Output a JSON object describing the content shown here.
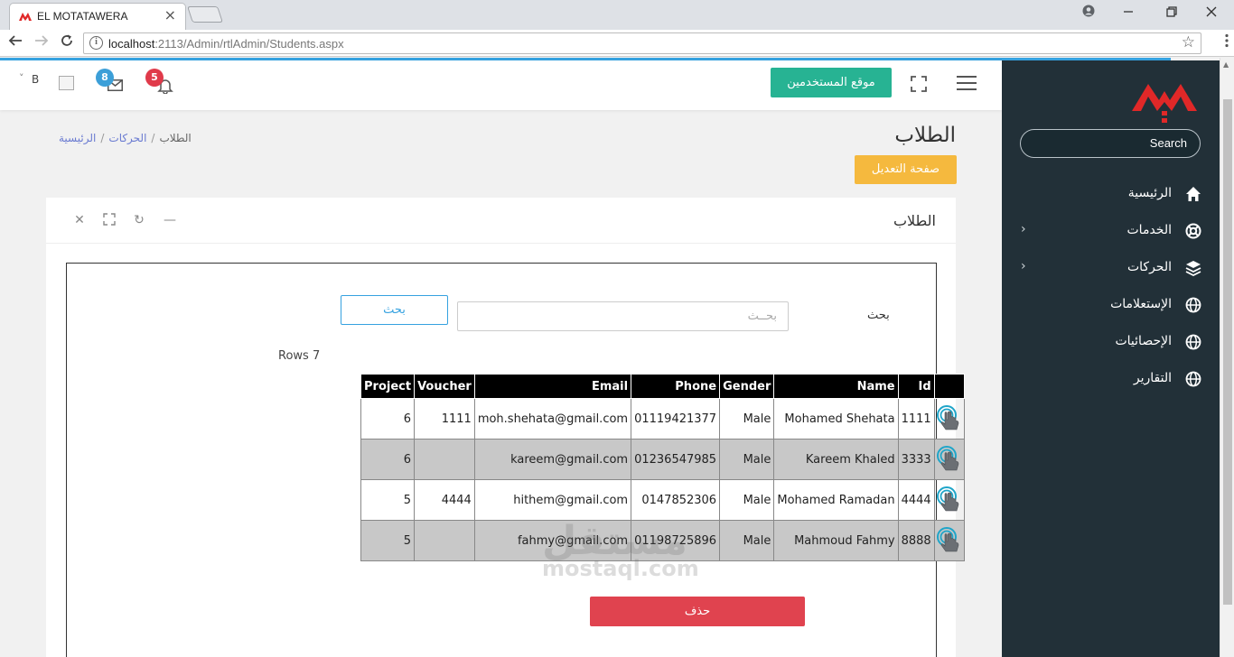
{
  "browser": {
    "tab_title": "EL MOTATAWERA",
    "tab_close": "×",
    "url_host": "localhost",
    "url_rest": ":2113/Admin/rtlAdmin/Students.aspx"
  },
  "sidebar": {
    "search_label": "Search",
    "items": [
      {
        "label": "الرئيسية",
        "icon": "home-icon"
      },
      {
        "label": "الخدمات",
        "icon": "lifebuoy-icon",
        "chevron": "‹"
      },
      {
        "label": "الحركات",
        "icon": "layers-icon",
        "chevron": "‹"
      },
      {
        "label": "الإستعلامات",
        "icon": "globe-icon"
      },
      {
        "label": "الإحصائيات",
        "icon": "globe-icon"
      },
      {
        "label": "التقارير",
        "icon": "globe-icon"
      }
    ]
  },
  "header": {
    "users_site_button": "موقع المستخدمين",
    "notifications_count": "5",
    "messages_count": "8",
    "user_initial": "B",
    "user_chevron": "˅"
  },
  "page": {
    "title": "الطلاب",
    "breadcrumb": {
      "home": "الرئيسية",
      "section": "الحركات",
      "current": "الطلاب"
    },
    "edit_button": "صفحة التعديل"
  },
  "card": {
    "title": "الطلاب",
    "tools": {
      "minimize": "—",
      "refresh": "↻",
      "expand": "⛶",
      "close": "✕"
    }
  },
  "search": {
    "label": "بحث",
    "placeholder": "بحــث",
    "button": "بحث"
  },
  "rows_count_text": "Rows 7",
  "table": {
    "headers": [
      "",
      "Id",
      "Name",
      "Gender",
      "Phone",
      "Email",
      "Voucher",
      "Project"
    ],
    "rows": [
      {
        "id": "1111",
        "name": "Mohamed Shehata",
        "gender": "Male",
        "phone": "01119421377",
        "email": "moh.shehata@gmail.com",
        "voucher": "1111",
        "project": "6"
      },
      {
        "id": "3333",
        "name": "Kareem Khaled",
        "gender": "Male",
        "phone": "01236547985",
        "email": "kareem@gmail.com",
        "voucher": "",
        "project": "6"
      },
      {
        "id": "4444",
        "name": "Mohamed Ramadan",
        "gender": "Male",
        "phone": "0147852306",
        "email": "hithem@gmail.com",
        "voucher": "4444",
        "project": "5"
      },
      {
        "id": "8888",
        "name": "Mahmoud Fahmy",
        "gender": "Male",
        "phone": "01198725896",
        "email": "fahmy@gmail.com",
        "voucher": "",
        "project": "5"
      }
    ]
  },
  "delete_button": "حذف",
  "watermark": {
    "arabic": "مستقل",
    "latin": "mostaql.com"
  },
  "colors": {
    "sidebar_bg": "#223038",
    "accent_blue": "#36a2e0",
    "green": "#27b393",
    "orange": "#f5b93e",
    "red": "#e0434f"
  }
}
